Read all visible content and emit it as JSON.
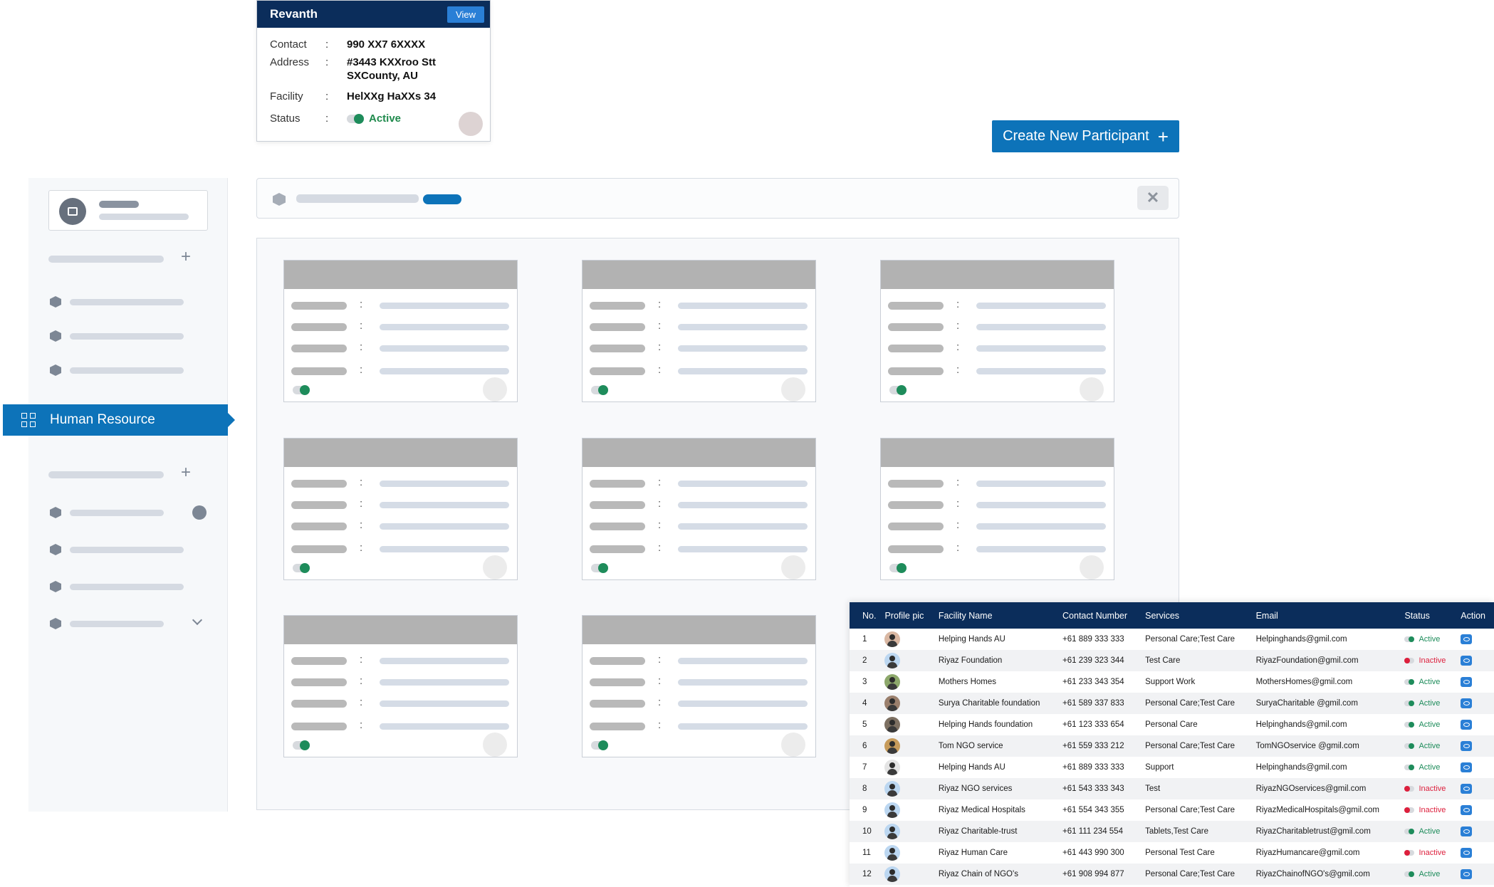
{
  "popup": {
    "name": "Revanth",
    "view_label": "View",
    "rows": [
      {
        "label": "Contact",
        "value": "990 XX7 6XXXX"
      },
      {
        "label": "Address",
        "value": "#3443 KXXroo Stt SXCounty, AU"
      },
      {
        "label": "Facility",
        "value": "HelXXg HaXXs 34"
      },
      {
        "label": "Status",
        "value": "Active"
      }
    ],
    "colon": ":"
  },
  "create_button": {
    "label": "Create New Participant",
    "icon": "plus-icon"
  },
  "sidebar": {
    "active_item": {
      "label": "Human Resource",
      "icon": "grid-icon"
    }
  },
  "search": {
    "clear_icon": "close-icon",
    "clear_glyph": "✕"
  },
  "card_colon": ":",
  "table": {
    "headers": [
      "No.",
      "Profile pic",
      "Facility Name",
      "Contact Number",
      "Services",
      "Email",
      "Status",
      "Action"
    ],
    "rows": [
      {
        "no": "1",
        "facility": "Helping Hands AU",
        "contact": "+61 889 333 333",
        "services": "Personal Care;Test Care",
        "email": "Helpinghands@gmil.com",
        "status": "Active",
        "avatar_color": "#d9b7a2"
      },
      {
        "no": "2",
        "facility": "Riyaz Foundation",
        "contact": "+61 239 323 344",
        "services": "Test Care",
        "email": "RiyazFoundation@gmil.com",
        "status": "Inactive",
        "avatar_color": "#bcd7f1"
      },
      {
        "no": "3",
        "facility": "Mothers Homes",
        "contact": "+61 233 343 354",
        "services": "Support Work",
        "email": "MothersHomes@gmil.com",
        "status": "Active",
        "avatar_color": "#8da86b"
      },
      {
        "no": "4",
        "facility": "Surya Charitable foundation",
        "contact": "+61 589 337 833",
        "services": "Personal Care;Test Care",
        "email": "SuryaCharitable @gmil.com",
        "status": "Active",
        "avatar_color": "#9a7f6c"
      },
      {
        "no": "5",
        "facility": "Helping Hands foundation",
        "contact": "+61 123 333 654",
        "services": "Personal Care",
        "email": "Helpinghands@gmil.com",
        "status": "Active",
        "avatar_color": "#7d7062"
      },
      {
        "no": "6",
        "facility": "Tom NGO service",
        "contact": "+61 559 333 212",
        "services": "Personal Care;Test Care",
        "email": "TomNGOservice @gmil.com",
        "status": "Active",
        "avatar_color": "#c79b5b"
      },
      {
        "no": "7",
        "facility": "Helping Hands AU",
        "contact": "+61 889 333 333",
        "services": "Support",
        "email": "Helpinghands@gmil.com",
        "status": "Active",
        "avatar_color": "#e4e4e4"
      },
      {
        "no": "8",
        "facility": "Riyaz NGO services",
        "contact": "+61 543 333 343",
        "services": "Test",
        "email": "RiyazNGOservices@gmil.com",
        "status": "Inactive",
        "avatar_color": "#bcd7f1"
      },
      {
        "no": "9",
        "facility": "Riyaz Medical Hospitals",
        "contact": "+61 554 343 355",
        "services": "Personal Care;Test Care",
        "email": "RiyazMedicalHospitals@gmil.com",
        "status": "Inactive",
        "avatar_color": "#bcd7f1"
      },
      {
        "no": "10",
        "facility": "Riyaz Charitable-trust",
        "contact": "+61 111 234 554",
        "services": "Tablets,Test Care",
        "email": "RiyazCharitabletrust@gmil.com",
        "status": "Active",
        "avatar_color": "#bcd7f1"
      },
      {
        "no": "11",
        "facility": "Riyaz Human Care",
        "contact": "+61 443 990 300",
        "services": "Personal Test Care",
        "email": "RiyazHumancare@gmil.com",
        "status": "Inactive",
        "avatar_color": "#bcd7f1"
      },
      {
        "no": "12",
        "facility": "Riyaz Chain of NGO's",
        "contact": "+61 908 994 877",
        "services": "Personal Care;Test Care",
        "email": "RiyazChainofNGO's@gmil.com",
        "status": "Active",
        "avatar_color": "#bcd7f1"
      }
    ],
    "action_icon": "eye-icon"
  },
  "colors": {
    "navy": "#0b2d5b",
    "accent_blue": "#0d73b9",
    "active_green": "#1e8c5b",
    "inactive_red": "#dd1f3c"
  }
}
